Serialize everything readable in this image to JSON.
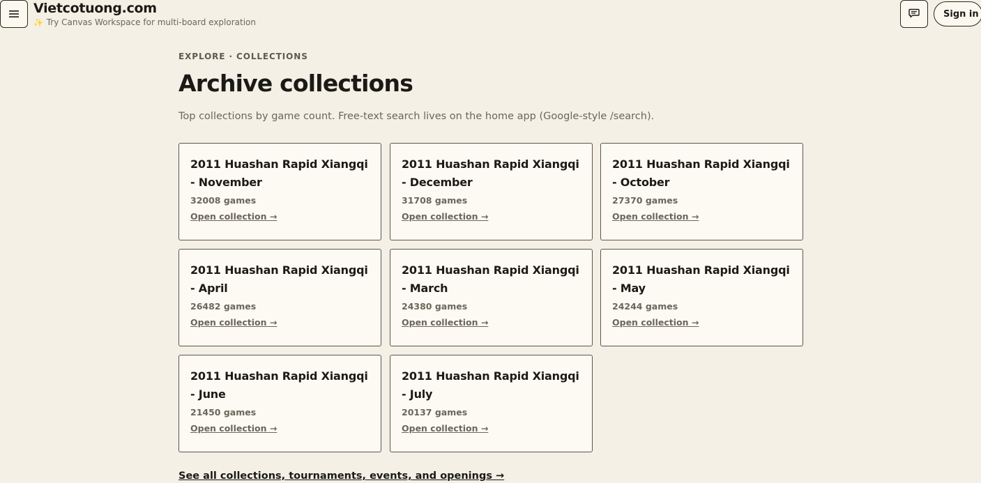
{
  "header": {
    "menu_icon": "hamburger-menu-icon",
    "brand_title": "Vietcotuong.com",
    "tip_icon": "sparkles-icon",
    "tip_glyph": "✨",
    "tip_text": "Try Canvas Workspace for multi-board exploration",
    "feedback_icon": "chat-bubble-icon",
    "signin_label": "Sign in"
  },
  "page": {
    "eyebrow": "EXPLORE · COLLECTIONS",
    "title": "Archive collections",
    "lede": "Top collections by game count. Free-text search lives on the home app (Google-style /search).",
    "see_all_label": "See all collections, tournaments, events, and openings →"
  },
  "collections": [
    {
      "title": "2011 Huashan Rapid Xiangqi - November",
      "count": "32008 games",
      "link": "Open collection →"
    },
    {
      "title": "2011 Huashan Rapid Xiangqi - December",
      "count": "31708 games",
      "link": "Open collection →"
    },
    {
      "title": "2011 Huashan Rapid Xiangqi - October",
      "count": "27370 games",
      "link": "Open collection →"
    },
    {
      "title": "2011 Huashan Rapid Xiangqi - April",
      "count": "26482 games",
      "link": "Open collection →"
    },
    {
      "title": "2011 Huashan Rapid Xiangqi - March",
      "count": "24380 games",
      "link": "Open collection →"
    },
    {
      "title": "2011 Huashan Rapid Xiangqi - May",
      "count": "24244 games",
      "link": "Open collection →"
    },
    {
      "title": "2011 Huashan Rapid Xiangqi - June",
      "count": "21450 games",
      "link": "Open collection →"
    },
    {
      "title": "2011 Huashan Rapid Xiangqi - July",
      "count": "20137 games",
      "link": "Open collection →"
    }
  ],
  "colors": {
    "background": "#f4f0e6",
    "card_background": "#fcfaf2",
    "text": "#1c1a16",
    "muted": "#6b665c"
  }
}
